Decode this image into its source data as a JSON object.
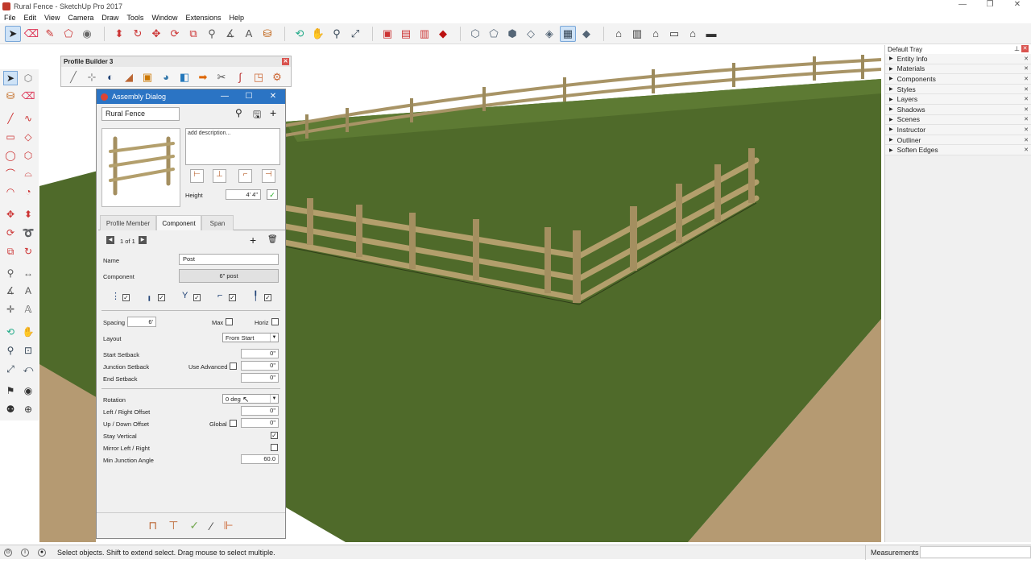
{
  "window": {
    "title": "Rural Fence - SketchUp Pro 2017",
    "min": "—",
    "max": "❐",
    "close": "✕"
  },
  "menu": [
    "File",
    "Edit",
    "View",
    "Camera",
    "Draw",
    "Tools",
    "Window",
    "Extensions",
    "Help"
  ],
  "profile_builder": {
    "title": "Profile Builder 3",
    "close": "✕"
  },
  "assembly": {
    "title": "Assembly Dialog",
    "name_value": "Rural Fence",
    "description_placeholder": "add description...",
    "height_label": "Height",
    "height_value": "4' 4\"",
    "tabs": [
      "Profile Member",
      "Component",
      "Span"
    ],
    "active_tab": "Component",
    "pager": "1 of 1",
    "fields": {
      "name_label": "Name",
      "name_value": "Post",
      "component_label": "Component",
      "component_value": "6\" post",
      "spacing_label": "Spacing",
      "spacing_value": "6'",
      "max_label": "Max",
      "horiz_label": "Horiz",
      "layout_label": "Layout",
      "layout_value": "From Start",
      "start_setback_label": "Start Setback",
      "start_setback_value": "0\"",
      "junction_setback_label": "Junction Setback",
      "use_advanced_label": "Use Advanced",
      "junction_setback_value": "0\"",
      "end_setback_label": "End Setback",
      "end_setback_value": "0\"",
      "rotation_label": "Rotation",
      "rotation_value": "0 deg",
      "lr_offset_label": "Left / Right Offset",
      "lr_offset_value": "0\"",
      "ud_offset_label": "Up / Down Offset",
      "global_label": "Global",
      "ud_offset_value": "0\"",
      "stay_vertical_label": "Stay Vertical",
      "stay_vertical_checked": true,
      "mirror_label": "Mirror Left / Right",
      "mirror_checked": false,
      "min_junction_label": "Min Junction Angle",
      "min_junction_value": "60.0"
    }
  },
  "tray": {
    "title": "Default Tray",
    "items": [
      "Entity Info",
      "Materials",
      "Components",
      "Styles",
      "Layers",
      "Shadows",
      "Scenes",
      "Instructor",
      "Outliner",
      "Soften Edges"
    ]
  },
  "status": {
    "hint": "Select objects. Shift to extend select. Drag mouse to select multiple.",
    "measurements_label": "Measurements",
    "measurements_value": ""
  },
  "colors": {
    "grass": "#4f6a2a",
    "dirt": "#b49a74",
    "wood": "#a89466",
    "titlebar_blue": "#2b74c4",
    "close_red": "#d9534f"
  },
  "icons": [
    "select-icon",
    "eraser-icon",
    "pencil-icon",
    "push-pull-icon",
    "move-icon",
    "rotate-icon",
    "zoom-icon",
    "orbit-icon",
    "pan-icon"
  ]
}
